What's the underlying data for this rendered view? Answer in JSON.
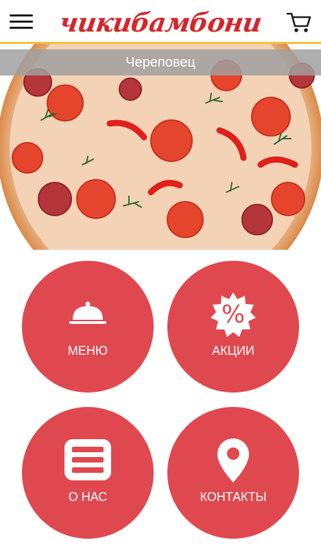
{
  "header": {
    "logo_text": "чикибамбони",
    "menu_icon": "hamburger-menu-icon",
    "cart_icon": "shopping-cart-icon"
  },
  "city": "Череповец",
  "tiles": [
    {
      "label": "МЕНЮ",
      "icon": "cloche-icon"
    },
    {
      "label": "АКЦИИ",
      "icon": "percent-badge-icon"
    },
    {
      "label": "О НАС",
      "icon": "list-icon"
    },
    {
      "label": "КОНТАКТЫ",
      "icon": "location-pin-icon"
    }
  ],
  "colors": {
    "brand_red": "#d5262c",
    "tile_red": "#e0484f",
    "accent_yellow": "#f2c23a"
  }
}
